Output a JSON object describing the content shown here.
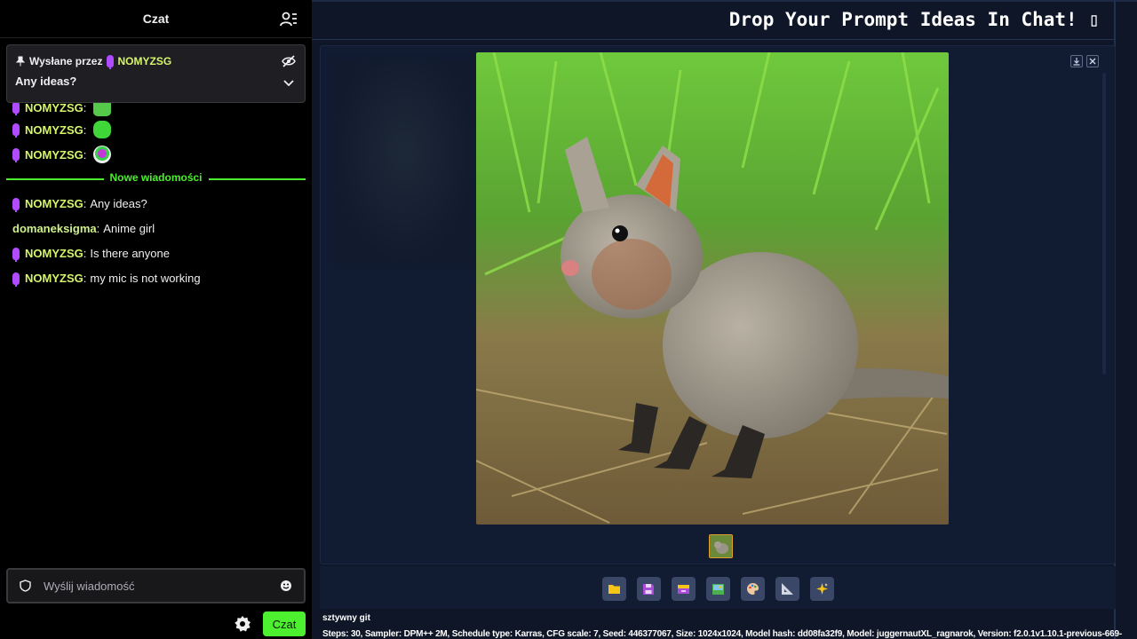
{
  "chat": {
    "header_title": "Czat",
    "pinned": {
      "sent_by_label": "Wysłane przez",
      "user": "NOMYZSG",
      "message": "Any ideas?"
    },
    "emote_lines": [
      {
        "user": "NOMYZSG",
        "sep": ":"
      },
      {
        "user": "NOMYZSG",
        "sep": ":"
      },
      {
        "user": "NOMYZSG",
        "sep": ":"
      }
    ],
    "new_messages_label": "Nowe wiadomości",
    "messages": [
      {
        "user": "NOMYZSG",
        "text": "Any ideas?"
      },
      {
        "user": "domaneksigma",
        "text": "Anime girl"
      },
      {
        "user": "NOMYZSG",
        "text": "Is there anyone"
      },
      {
        "user": "NOMYZSG",
        "text": "my mic is not working"
      }
    ],
    "input_placeholder": "Wyślij wiadomość",
    "send_label": "Czat"
  },
  "main": {
    "banner": "Drop Your Prompt Ideas In Chat! ▯",
    "info_title": "sztywny git",
    "info_params": "Steps: 30, Sampler: DPM++ 2M, Schedule type: Karras, CFG scale: 7, Seed: 446377067, Size: 1024x1024, Model hash: dd08fa32f9, Model: juggernautXL_ragnarok, Version: f2.0.1v1.10.1-previous-669-"
  },
  "icons": [
    "users-icon",
    "pin-icon",
    "mic-icon",
    "hide-icon",
    "chevron-down-icon",
    "shield-icon",
    "emoji-icon",
    "gear-icon",
    "download-icon",
    "close-icon",
    "folder-icon",
    "save-icon",
    "send-to-img2img-icon",
    "image-icon",
    "palette-icon",
    "ruler-icon",
    "sparkle-icon"
  ],
  "colors": {
    "accent_green": "#4cf02e",
    "username_yellow": "#d6f56a",
    "mic_purple": "#b04bff"
  }
}
